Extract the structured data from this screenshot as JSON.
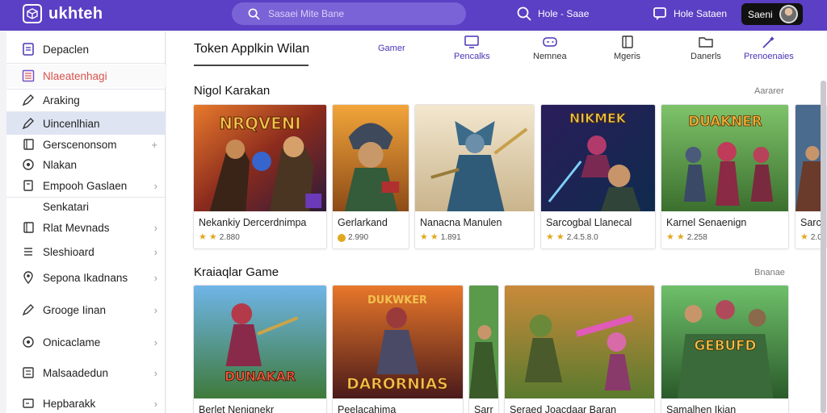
{
  "header": {
    "logo_text": "ukhteh",
    "search_placeholder": "Sasaei Mite Bane",
    "link1_label": "Hole - Saae",
    "link2_label": "Hole Sataen",
    "profile_label": "Saeni",
    "brand_color": "#5b3fc4"
  },
  "sidebar": {
    "items": [
      {
        "label": "Depaclen",
        "icon": "document-icon"
      },
      {
        "label": "Nlaeatenhagi",
        "icon": "grid-icon"
      },
      {
        "label": "Araking",
        "icon": "pen-icon"
      },
      {
        "label": "Uincenlhian",
        "icon": "pen-icon"
      },
      {
        "label": "Gerscenonsom",
        "icon": "book-icon"
      },
      {
        "label": "Nlakan",
        "icon": "circle-icon"
      },
      {
        "label": "Empooh Gaslaen",
        "icon": "tag-icon"
      },
      {
        "label": "Senkatari",
        "icon": "none"
      },
      {
        "label": "Rlat Mevnads",
        "icon": "book-icon"
      },
      {
        "label": "Sleshioard",
        "icon": "bars-icon"
      },
      {
        "label": "Sepona Ikadnans",
        "icon": "location-icon"
      },
      {
        "label": "Grooge Iinan",
        "icon": "pen-icon"
      },
      {
        "label": "Onicaclame",
        "icon": "circle-icon"
      },
      {
        "label": "Malsaadedun",
        "icon": "list-icon"
      },
      {
        "label": "Hepbarakk",
        "icon": "square-icon"
      }
    ]
  },
  "main": {
    "title": "Token Applkin Wilan",
    "tabs": [
      {
        "label": "Gamer",
        "icon": "none"
      },
      {
        "label": "Pencalks",
        "icon": "monitor-icon"
      },
      {
        "label": "Nemnea",
        "icon": "gamepad-icon"
      },
      {
        "label": "Mgeris",
        "icon": "book-icon"
      },
      {
        "label": "Danerls",
        "icon": "folder-icon"
      },
      {
        "label": "Prenoenaies",
        "icon": "wand-icon"
      }
    ],
    "section1": {
      "title": "Nigol Karakan",
      "see_all": "Aararer",
      "cards": [
        {
          "name": "Nekankiy Dercerdnimpa",
          "rating": "2.880",
          "rating_icon": "star"
        },
        {
          "name": "Gerlarkand",
          "rating": "2.990",
          "rating_icon": "coin"
        },
        {
          "name": "Nanacna Manulen",
          "rating": "1.891",
          "rating_icon": "star"
        },
        {
          "name": "Sarcogbal Llanecal",
          "rating": "2.4.5.8.0",
          "rating_icon": "star"
        },
        {
          "name": "Karnel Senaenign",
          "rating": "2.258",
          "rating_icon": "star"
        },
        {
          "name": "Sarc",
          "rating": "2.0",
          "rating_icon": "star"
        }
      ]
    },
    "section2": {
      "title": "Kraiaqlar Game",
      "see_all": "Bnanae",
      "cards": [
        {
          "name": "Berlet Nenignekr"
        },
        {
          "name": "Peelacahima"
        },
        {
          "name": "Sarr"
        },
        {
          "name": "Seraed Joacdaar Baran"
        },
        {
          "name": "Samalhen Ikian"
        }
      ]
    }
  },
  "colors": {
    "accent": "#5b3fc4",
    "highlight_red": "#d9534f",
    "selected_bg": "#dfe4f3",
    "star": "#e0a81e"
  }
}
